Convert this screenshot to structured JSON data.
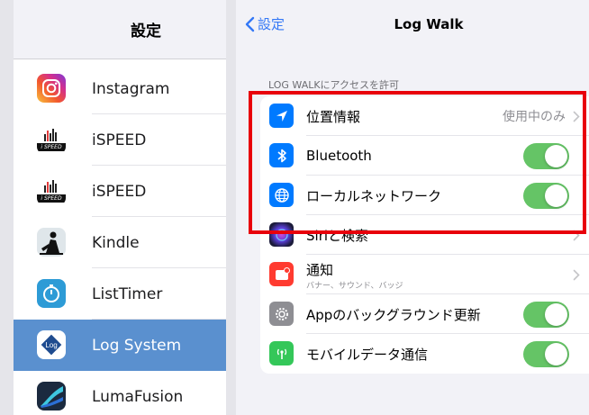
{
  "settings_list": {
    "title": "設定",
    "apps": [
      {
        "label": "Instagram",
        "icon": "instagram-icon",
        "selected": false
      },
      {
        "label": "iSPEED",
        "icon": "ispeed-icon",
        "selected": false
      },
      {
        "label": "iSPEED",
        "icon": "ispeed-icon",
        "selected": false
      },
      {
        "label": "Kindle",
        "icon": "kindle-icon",
        "selected": false
      },
      {
        "label": "ListTimer",
        "icon": "listtimer-icon",
        "selected": false
      },
      {
        "label": "Log System",
        "icon": "log-system-icon",
        "selected": true
      },
      {
        "label": "LumaFusion",
        "icon": "lumafusion-icon",
        "selected": false
      }
    ],
    "ispeed_icon_text": "i SPEED"
  },
  "detail": {
    "back_label": "設定",
    "title": "Log Walk",
    "section_caption": "LOG WALKにアクセスを許可",
    "rows": {
      "location": {
        "label": "位置情報",
        "value": "使用中のみ",
        "icon": "location-arrow-icon",
        "icon_color": "#007aff"
      },
      "bluetooth": {
        "label": "Bluetooth",
        "enabled": true,
        "icon": "bluetooth-icon",
        "icon_color": "#007aff"
      },
      "local_network": {
        "label": "ローカルネットワーク",
        "enabled": true,
        "icon": "globe-icon",
        "icon_color": "#007aff"
      },
      "siri": {
        "label": "Siriと検索",
        "icon": "siri-icon"
      },
      "notifications": {
        "label": "通知",
        "sublabel": "バナー、サウンド、バッジ",
        "icon": "notification-bell-icon",
        "icon_color": "#ff3b30"
      },
      "background_refresh": {
        "label": "Appのバックグラウンド更新",
        "enabled": true,
        "icon": "gear-icon",
        "icon_color": "#8e8e93"
      },
      "mobile_data": {
        "label": "モバイルデータ通信",
        "enabled": true,
        "icon": "antenna-icon",
        "icon_color": "#34c759"
      }
    }
  },
  "colors": {
    "accent": "#3478f6",
    "toggle_on": "#65c466",
    "selection": "#5a90cf",
    "highlight": "#e8000b"
  }
}
